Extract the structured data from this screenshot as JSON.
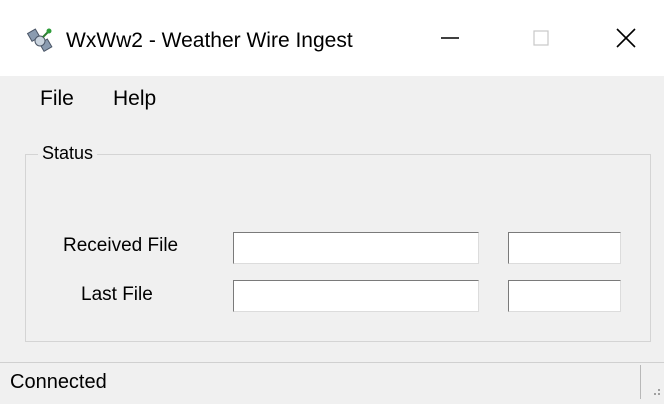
{
  "window": {
    "title": "WxWw2 - Weather Wire Ingest",
    "icon": "satellite-icon",
    "controls": [
      "minimize-icon",
      "maximize-icon",
      "close-icon"
    ]
  },
  "menu": {
    "items": [
      {
        "label": "File"
      },
      {
        "label": "Help"
      }
    ]
  },
  "status_group": {
    "legend": "Status",
    "received_file_label": "Received File",
    "last_file_label": "Last File",
    "received_file_value": "",
    "received_time_value": "",
    "last_file_value": "",
    "last_time_value": ""
  },
  "statusbar": {
    "text": "Connected"
  }
}
